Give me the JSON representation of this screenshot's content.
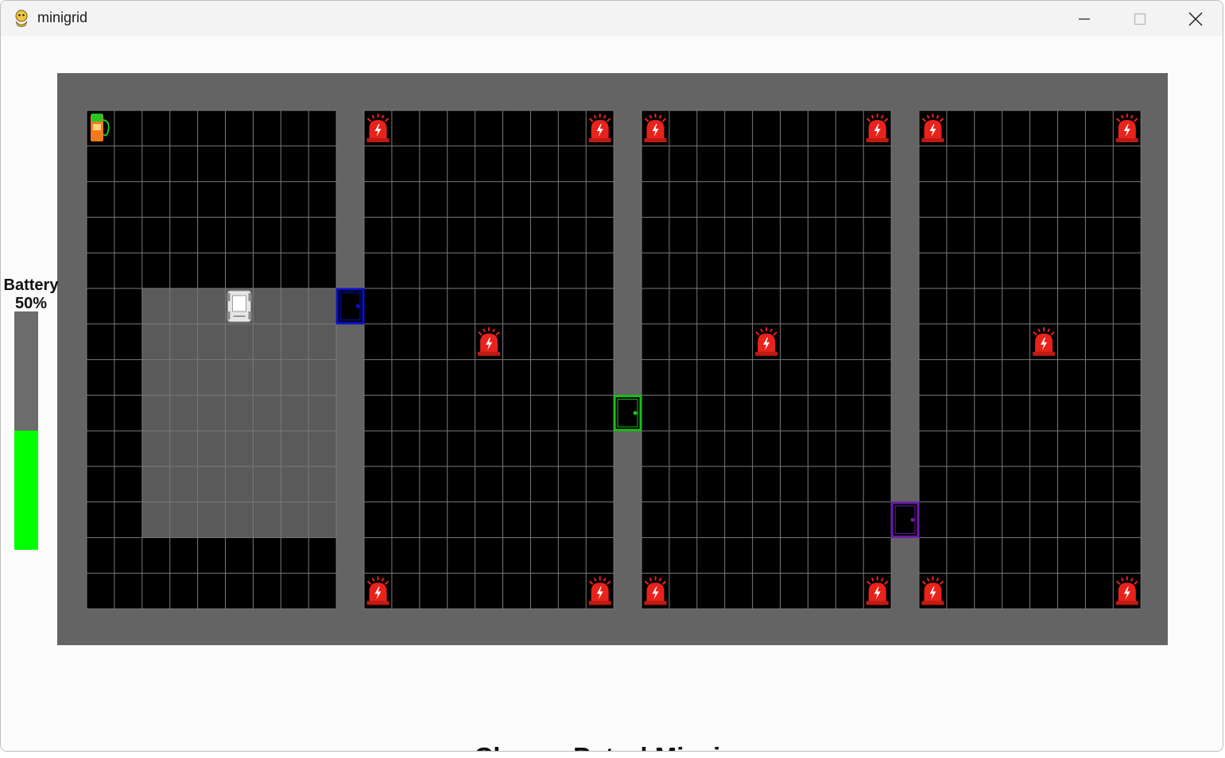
{
  "window": {
    "title": "minigrid"
  },
  "battery": {
    "label": "Battery",
    "percent_text": "50%",
    "level": 0.5,
    "fill_color": "#00ff00"
  },
  "mission": {
    "title": "Charge-Patrol Mission"
  },
  "colors": {
    "wall": "#646464",
    "floor": "#000000",
    "grid_line": "#7a7a7a",
    "highlight": "#5a5a5a",
    "alarm": "#e8231b"
  },
  "grid": {
    "columns": 38,
    "rows": 14,
    "rooms": [
      {
        "name": "room-1",
        "col_start": 0,
        "col_end": 8
      },
      {
        "name": "room-2",
        "col_start": 10,
        "col_end": 18
      },
      {
        "name": "room-3",
        "col_start": 20,
        "col_end": 28
      },
      {
        "name": "room-4",
        "col_start": 30,
        "col_end": 37
      }
    ],
    "highlight_region": {
      "col_start": 2,
      "col_end": 8,
      "row_start": 5,
      "row_end": 11
    },
    "agent": {
      "col": 5,
      "row": 5,
      "icon": "robot-icon"
    },
    "charger": {
      "col": 0,
      "row": 0,
      "icon": "charging-station-icon"
    },
    "doors": [
      {
        "col": 9,
        "row": 5,
        "color": "#0a10c8"
      },
      {
        "col": 19,
        "row": 8,
        "color": "#18c018"
      },
      {
        "col": 29,
        "row": 11,
        "color": "#6a1ca8"
      }
    ],
    "alarms": [
      {
        "col": 10,
        "row": 0
      },
      {
        "col": 18,
        "row": 0
      },
      {
        "col": 14,
        "row": 6
      },
      {
        "col": 10,
        "row": 13
      },
      {
        "col": 18,
        "row": 13
      },
      {
        "col": 20,
        "row": 0
      },
      {
        "col": 28,
        "row": 0
      },
      {
        "col": 24,
        "row": 6
      },
      {
        "col": 20,
        "row": 13
      },
      {
        "col": 28,
        "row": 13
      },
      {
        "col": 30,
        "row": 0
      },
      {
        "col": 37,
        "row": 0
      },
      {
        "col": 34,
        "row": 6
      },
      {
        "col": 30,
        "row": 13
      },
      {
        "col": 37,
        "row": 13
      }
    ]
  }
}
